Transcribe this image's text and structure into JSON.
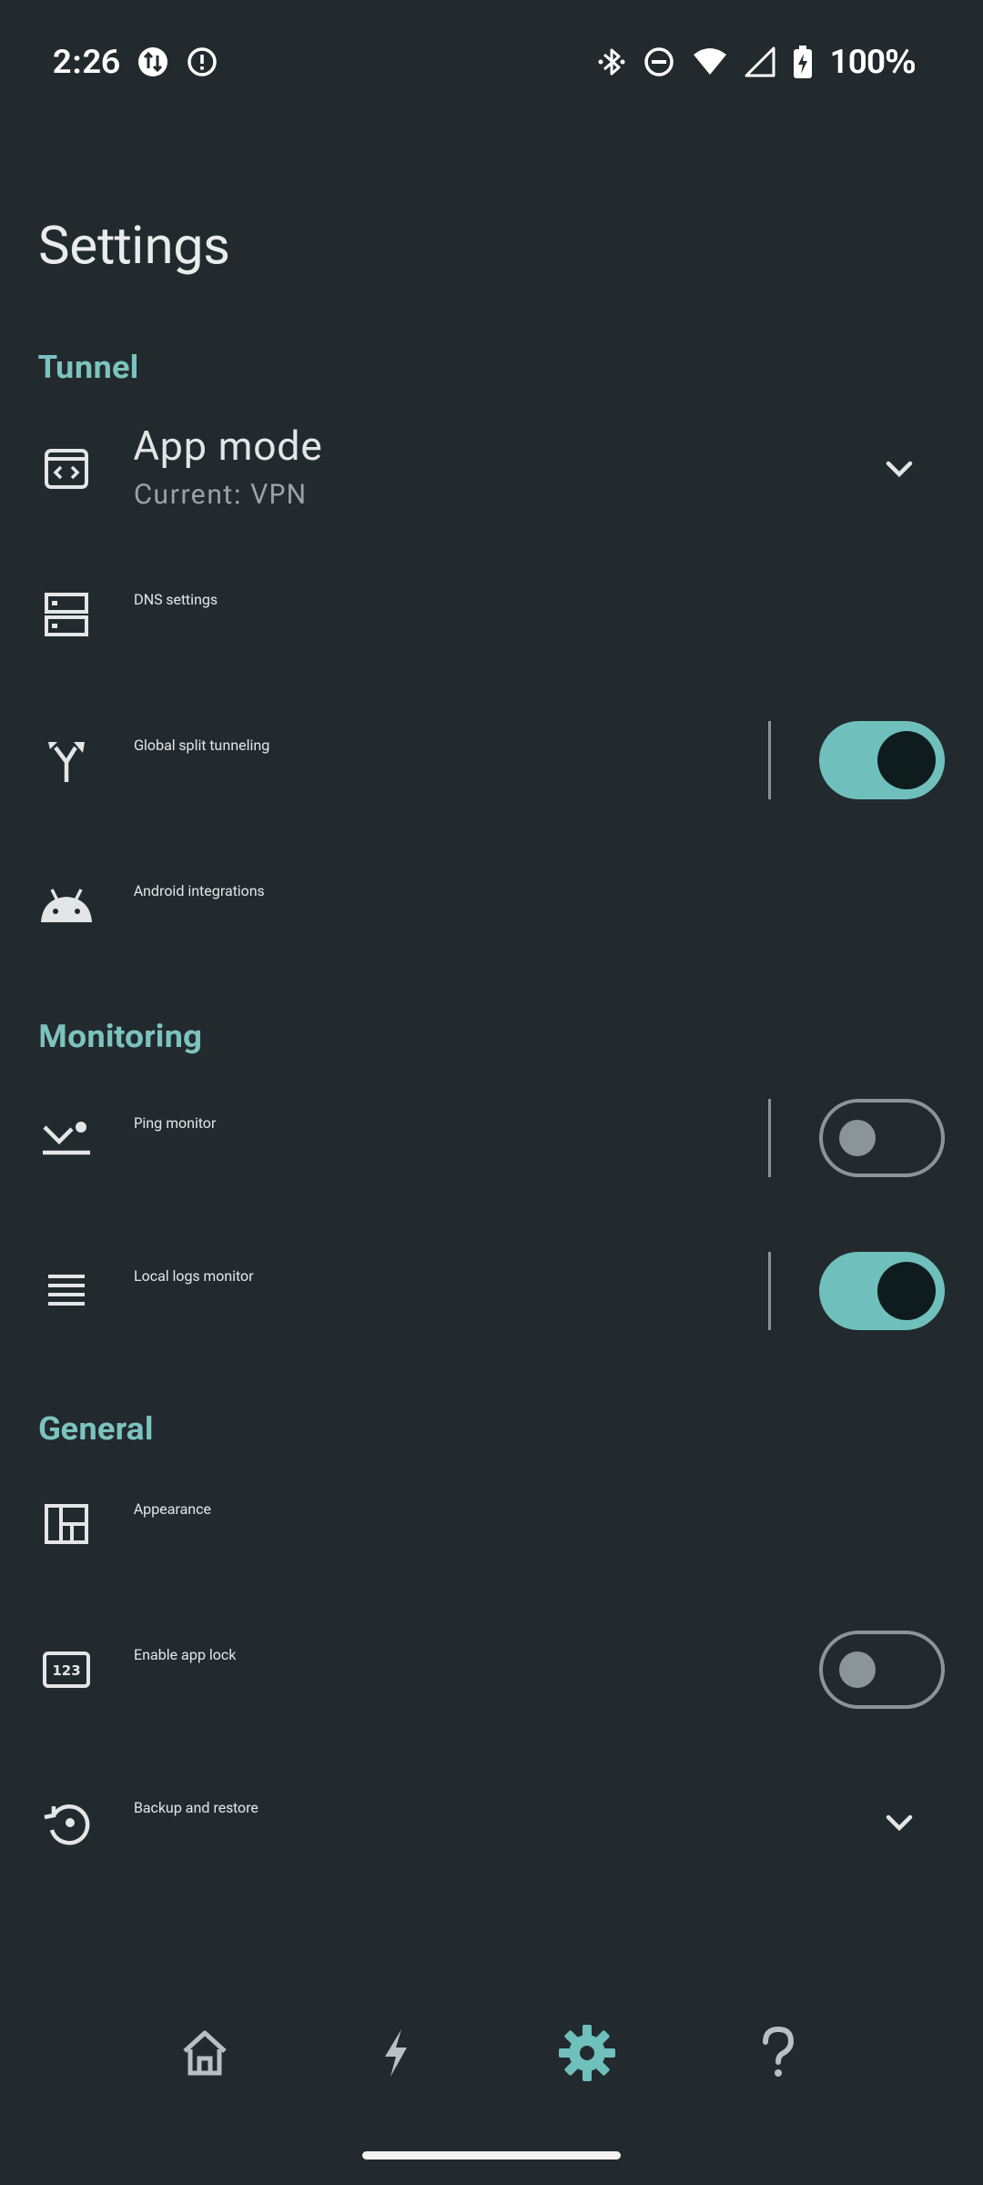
{
  "status_bar": {
    "time": "2:26",
    "battery": "100%",
    "left_icons": [
      "data-transfer-icon",
      "alert-icon"
    ],
    "right_icons": [
      "bluetooth-icon",
      "do-not-disturb-icon",
      "wifi-icon",
      "cell-signal-icon",
      "battery-charging-icon"
    ]
  },
  "page": {
    "title": "Settings"
  },
  "sections": {
    "tunnel": {
      "header": "Tunnel",
      "app_mode": {
        "label": "App mode",
        "sub": "Current: VPN",
        "icon": "code-window-icon"
      },
      "dns": {
        "label": "DNS settings",
        "icon": "dns-icon"
      },
      "split": {
        "label": "Global split tunneling",
        "icon": "split-arrows-icon",
        "toggle": true
      },
      "android": {
        "label": "Android integrations",
        "icon": "android-icon"
      }
    },
    "monitoring": {
      "header": "Monitoring",
      "ping": {
        "label": "Ping monitor",
        "icon": "ping-icon",
        "toggle": false
      },
      "logs": {
        "label": "Local logs monitor",
        "icon": "list-icon",
        "toggle": true
      }
    },
    "general": {
      "header": "General",
      "appearance": {
        "label": "Appearance",
        "icon": "layout-icon"
      },
      "app_lock": {
        "label": "Enable app lock",
        "icon": "pin-icon",
        "toggle": false
      },
      "backup": {
        "label": "Backup and restore",
        "icon": "restore-icon"
      }
    }
  },
  "bottom_nav": {
    "items": [
      "home-icon",
      "bolt-icon",
      "gear-icon",
      "help-icon"
    ],
    "active": "gear-icon"
  },
  "colors": {
    "background": "#222a2d",
    "accent": "#6fc0bc",
    "section_header": "#7cc3bf",
    "text": "#e3e6e7"
  }
}
